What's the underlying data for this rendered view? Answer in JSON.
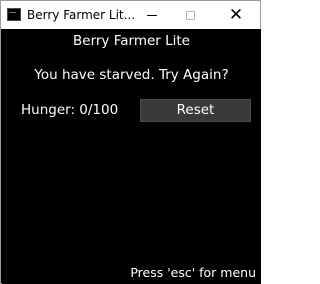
{
  "window": {
    "title": "Berry Farmer Lit...",
    "minimize_icon": "minimize-icon",
    "maximize_icon": "maximize-icon",
    "close_icon": "close-icon",
    "close_glyph": "✕"
  },
  "game": {
    "title": "Berry Farmer Lite",
    "message": "You have starved. Try Again?",
    "hunger_label": "Hunger: 0/100",
    "hunger_value": 0,
    "hunger_max": 100,
    "reset_label": "Reset",
    "menu_hint": "Press 'esc' for menu"
  },
  "colors": {
    "background": "#000000",
    "text": "#ffffff",
    "button": "#3a3a3d",
    "titlebar": "#ffffff"
  }
}
